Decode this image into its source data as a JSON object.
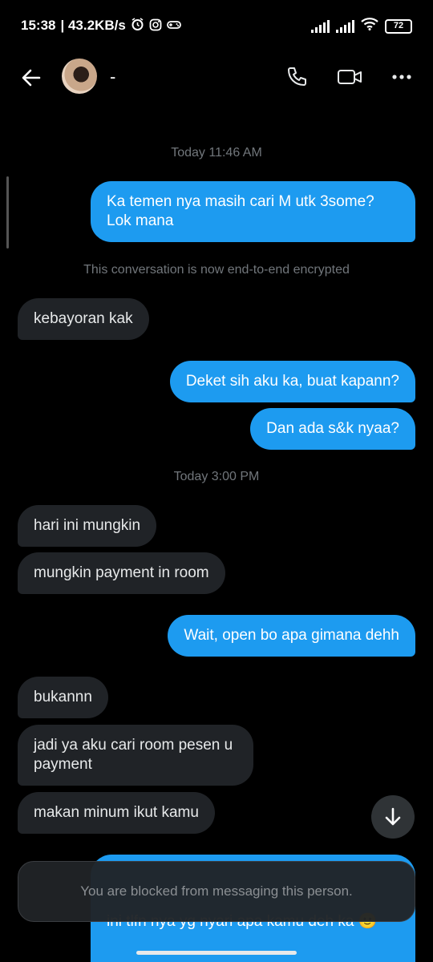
{
  "status_bar": {
    "time": "15:38",
    "network_speed": "| 43.2KB/s",
    "battery": "72",
    "icons": [
      "alarm-icon",
      "instagram-icon",
      "game-icon",
      "signal-icon",
      "signal-icon",
      "wifi-icon",
      "battery-icon"
    ]
  },
  "header": {
    "contact_name": "-",
    "icons": [
      "back-arrow-icon",
      "phone-icon",
      "video-icon",
      "more-icon"
    ]
  },
  "messages": [
    {
      "type": "timestamp",
      "text": "Today 11:46 AM"
    },
    {
      "type": "out",
      "text": "Ka temen nya masih cari M utk 3some? Lok mana"
    },
    {
      "type": "system",
      "text": "This conversation is now end-to-end encrypted"
    },
    {
      "type": "in",
      "text": "kebayoran kak"
    },
    {
      "type": "out",
      "text": "Deket sih aku ka, buat kapann?"
    },
    {
      "type": "out",
      "text": "Dan ada s&k nyaa?"
    },
    {
      "type": "timestamp",
      "text": "Today 3:00 PM"
    },
    {
      "type": "in",
      "text": "hari ini mungkin"
    },
    {
      "type": "in",
      "text": "mungkin payment in room"
    },
    {
      "type": "out",
      "text": "Wait, open bo apa gimana dehh"
    },
    {
      "type": "in",
      "text": "bukannn"
    },
    {
      "type": "in",
      "text": "jadi ya aku cari room pesen u payment"
    },
    {
      "type": "in",
      "text": "makan minum ikut kamu"
    },
    {
      "type": "out",
      "text": "ini tlfn nya yg nyari apa kamu deh ka 🙂"
    }
  ],
  "blocked_notice": "You are blocked from messaging this person.",
  "colors": {
    "accent": "#1d9bf0",
    "incoming_bubble": "#202327",
    "background": "#000000"
  }
}
